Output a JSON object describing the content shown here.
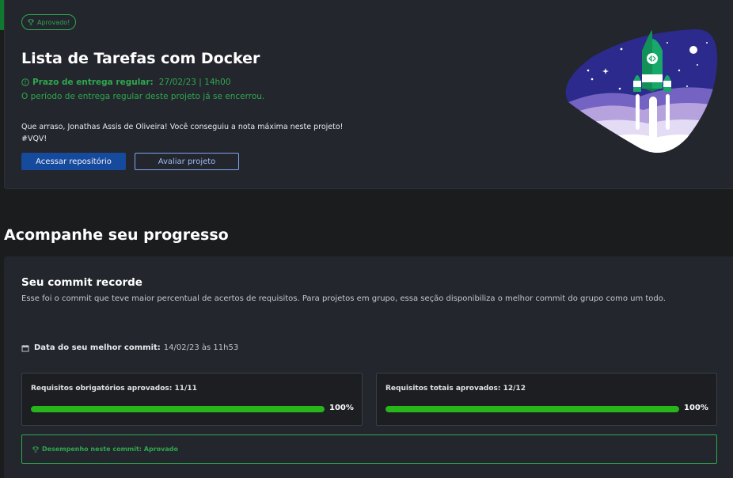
{
  "project": {
    "badge": "Aprovado!",
    "title": "Lista de Tarefas com Docker",
    "deadline_label": "Prazo de entrega regular:",
    "deadline_value": "27/02/23 | 14h00",
    "deadline_note": "O período de entrega regular deste projeto já se encerrou.",
    "congrats_line1": "Que arraso, Jonathas Assis de Oliveira! Você conseguiu a nota máxima neste projeto!",
    "congrats_line2": "#VQV!",
    "repo_button": "Acessar repositório",
    "rate_button": "Avaliar projeto"
  },
  "progress": {
    "section_title": "Acompanhe seu progresso",
    "commit_title": "Seu commit recorde",
    "commit_desc": "Esse foi o commit que teve maior percentual de acertos de requisitos. Para projetos em grupo, essa seção disponibiliza o melhor commit do grupo como um todo.",
    "best_date_label": "Data do seu melhor commit:",
    "best_date_value": "14/02/23 às 11h53",
    "mandatory": {
      "label": "Requisitos obrigatórios aprovados: 11/11",
      "percent_text": "100%",
      "percent": 100
    },
    "total": {
      "label": "Requisitos totais aprovados: 12/12",
      "percent_text": "100%",
      "percent": 100
    },
    "performance": "Desempenho neste commit: Aprovado"
  },
  "colors": {
    "accent_green": "#2fa84f",
    "bar_green": "#28b51a",
    "primary_blue": "#164a9c",
    "card_bg": "#23262d"
  },
  "icons": [
    "trophy-icon",
    "clock-icon",
    "calendar-icon",
    "rocket-illustration"
  ]
}
